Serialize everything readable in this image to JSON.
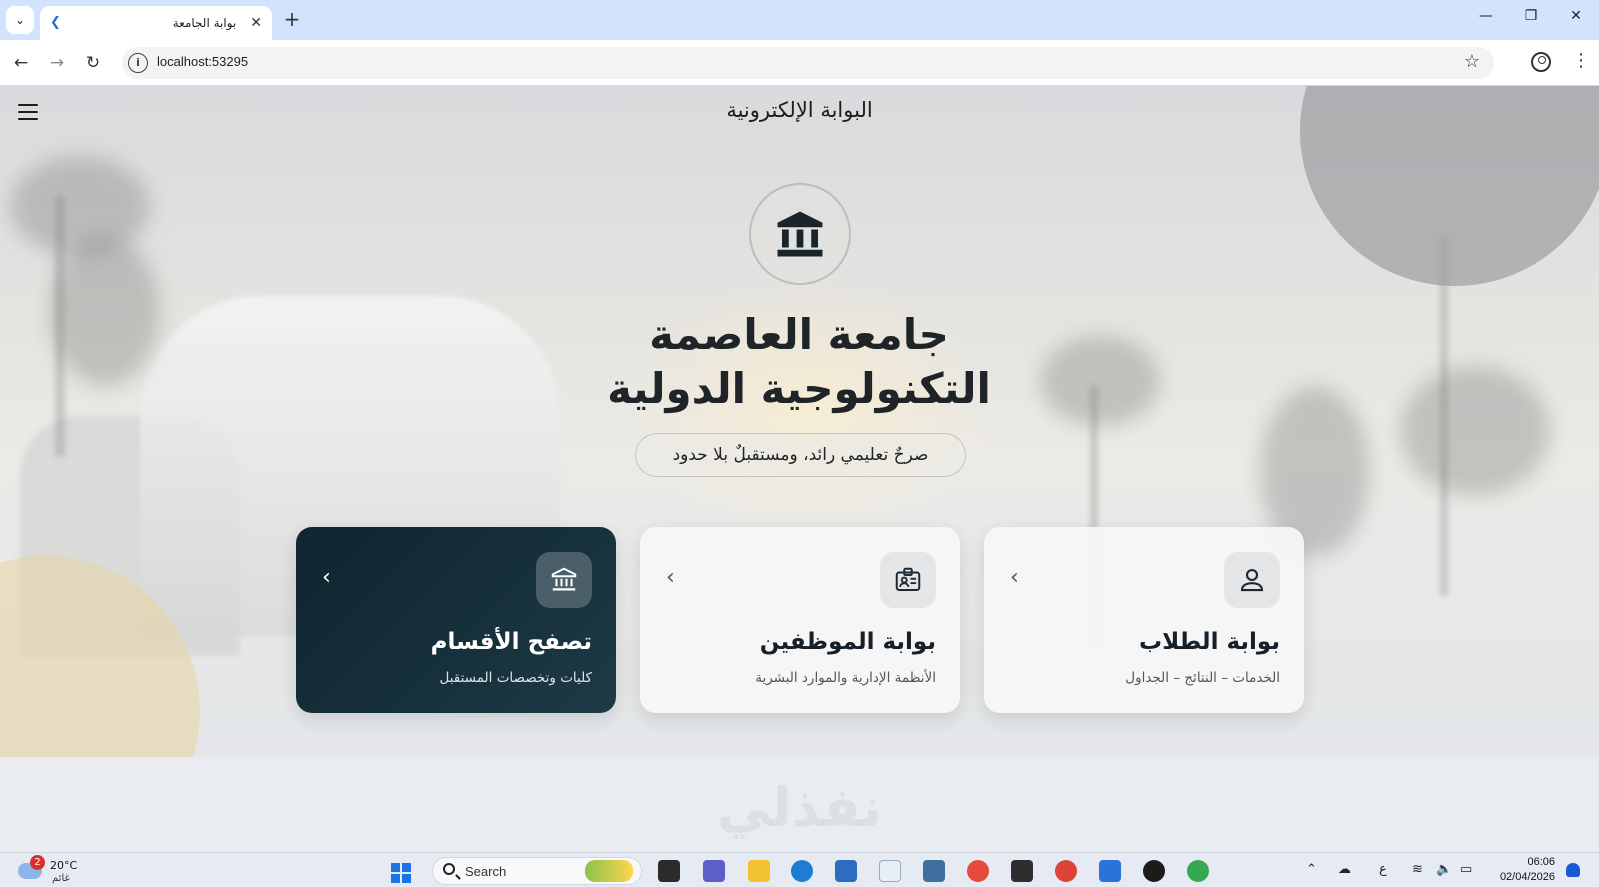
{
  "browser": {
    "tab_title": "بوابة الجامعة",
    "url": "localhost:53295",
    "new_tab": "+",
    "close_tab": "✕"
  },
  "app": {
    "title": "البوابة الإلكترونية"
  },
  "hero": {
    "university_name": "جامعة العاصمة التكنولوجية الدولية",
    "slogan": "صرحٌ تعليمي رائد، ومستقبلٌ بلا حدود"
  },
  "cards": [
    {
      "title": "تصفح الأقسام",
      "subtitle": "كليات وتخصصات المستقبل",
      "icon": "institution-icon"
    },
    {
      "title": "بوابة الموظفين",
      "subtitle": "الأنظمة الإدارية والموارد البشرية",
      "icon": "id-badge-icon"
    },
    {
      "title": "بوابة الطلاب",
      "subtitle": "الخدمات – النتائج – الجداول",
      "icon": "person-icon"
    }
  ],
  "watermark": "نفذلي",
  "taskbar": {
    "weather_temp": "20°C",
    "weather_desc": "غائم",
    "weather_badge": "2",
    "search_placeholder": "Search",
    "language": "ع",
    "time": "06:06",
    "date": "02/04/2026"
  },
  "colors": {
    "dark_card": "#0f2530",
    "accent_blue": "#1a73e8"
  }
}
